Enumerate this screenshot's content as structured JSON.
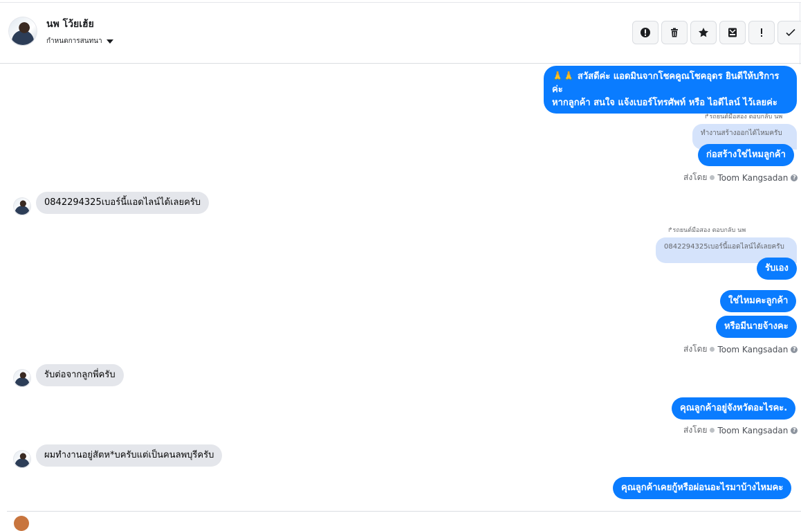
{
  "header": {
    "contact_name": "นพ โว้ยเฮ้ย",
    "assign_label": "กำหนดการสนทนา",
    "toolbar": {
      "mark_spam": "exclamation-circle-icon",
      "delete": "trash-icon",
      "star": "star-icon",
      "archive": "archive-icon",
      "important": "exclamation-icon",
      "done": "check-icon"
    }
  },
  "messages": {
    "m1_line1": "🙏🙏 สวัสดีค่ะ แอดมินจากโชคคูณโชคอุดร ยินดีให้บริการค่ะ",
    "m1_line2": "หากลูกค้า สนใจ แจ้งเบอร์โทรศัพท์ หรือ ไอดีไลน์  ไว้เลยค่ะ",
    "reply1_label": "↱รถยนต์มือสอง ตอบกลับ นพ",
    "reply1_quote": "ทำงานสร้างออกได้ไหมครับ",
    "m2": "ก่อสร้างใช่ไหมลูกค้า",
    "sent_by_1": "ส่งโดย",
    "agent_1": "Toom Kangsadan",
    "in1": "0842294325เบอร์นี้แอดไลน์ได้เลยครับ",
    "reply2_label": "↱รถยนต์มือสอง ตอบกลับ นพ",
    "reply2_quote": "0842294325เบอร์นี้แอดไลน์ได้เลยครับ",
    "m3": "รับเอง",
    "m4": "ใช่ไหมคะลูกค้า",
    "m5": "หรือมีนายจ้างคะ",
    "sent_by_2": "ส่งโดย",
    "agent_2": "Toom Kangsadan",
    "in2": "รับต่อจากลูกพี่ครับ",
    "m6": "คุณลูกค้าอยู่จังหวัดอะไรคะ.",
    "sent_by_3": "ส่งโดย",
    "agent_3": "Toom Kangsadan",
    "in3": "ผมทำงานอยู่สัตห*บครับแต่เป็นคนลพบุรีครับ",
    "m7": "คุณลูกค้าเคยกู้หรือผ่อนอะไรมาบ้างไหมคะ"
  },
  "colors": {
    "outgoing": "#0a7cff",
    "incoming": "#e4e6eb",
    "quote": "#d5e3fb"
  }
}
